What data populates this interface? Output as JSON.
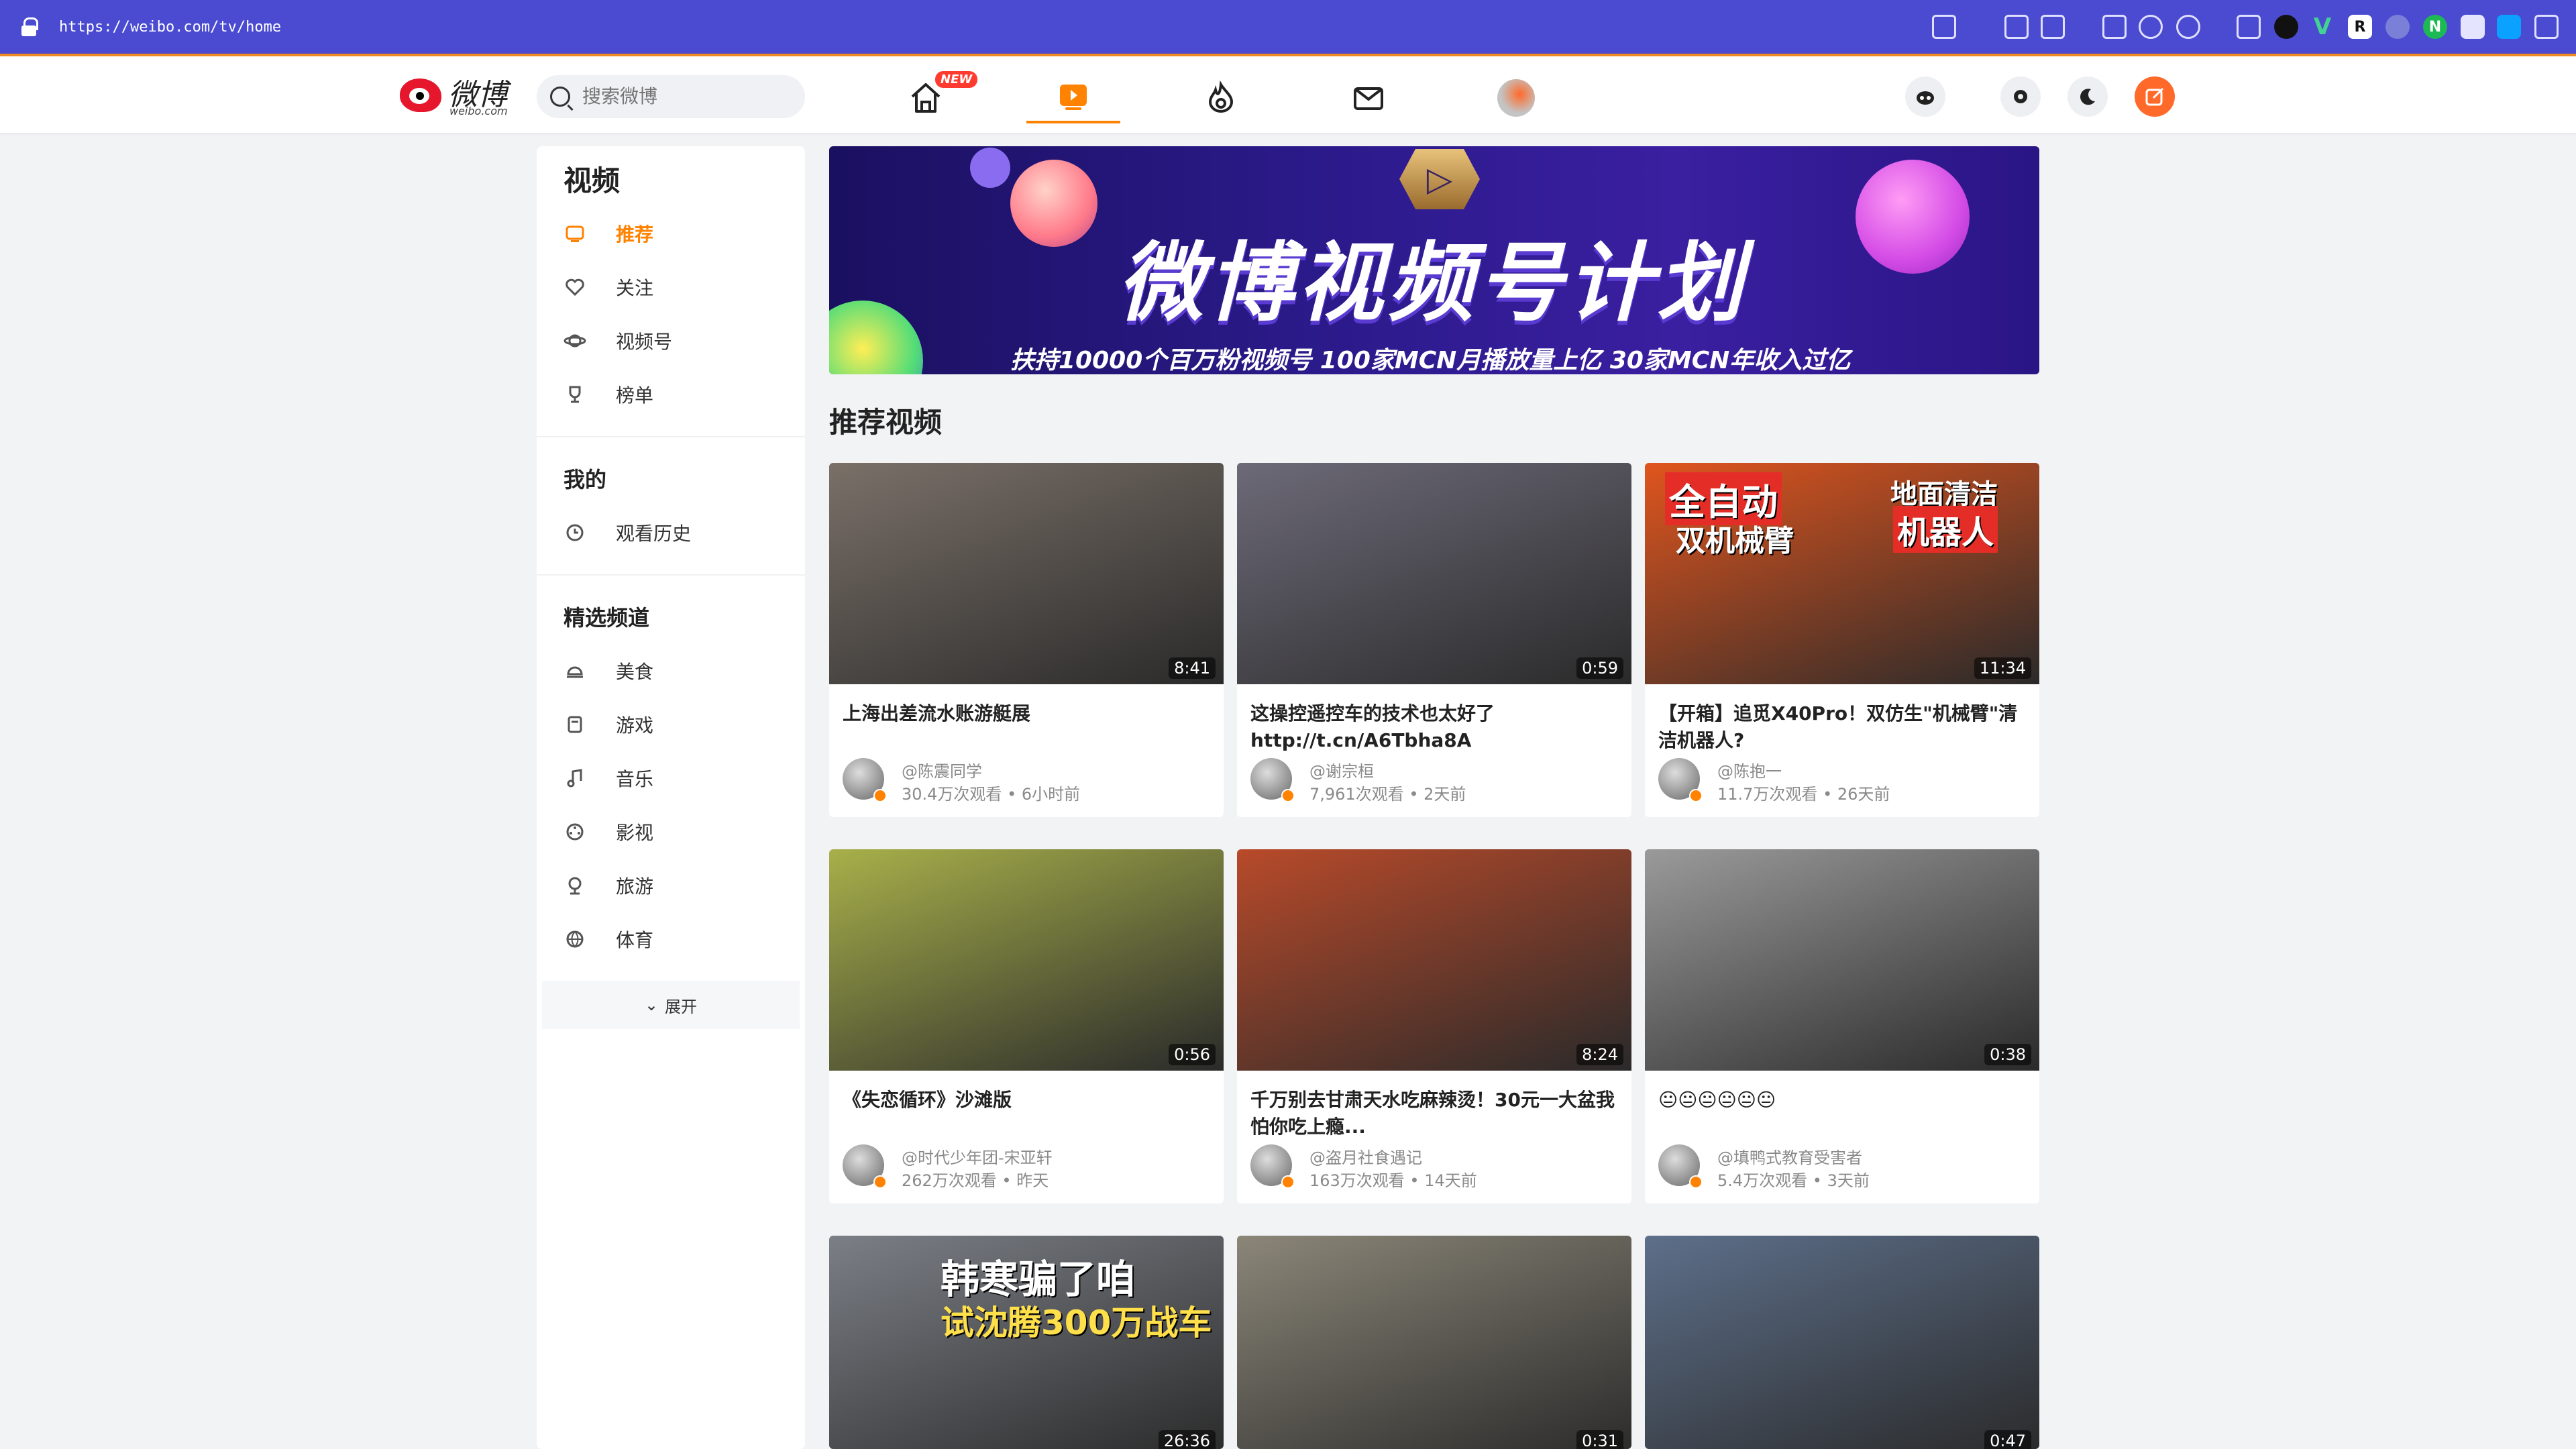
{
  "browser": {
    "url": "https://weibo.com/tv/home"
  },
  "header": {
    "logo_text": "微博",
    "logo_sub": "weibo.com",
    "search_placeholder": "搜索微博",
    "new_badge": "NEW"
  },
  "sidebar": {
    "title": "视频",
    "main_items": [
      {
        "label": "推荐",
        "icon": "tv-icon",
        "active": true
      },
      {
        "label": "关注",
        "icon": "heart-icon"
      },
      {
        "label": "视频号",
        "icon": "planet-icon"
      },
      {
        "label": "榜单",
        "icon": "trophy-icon"
      }
    ],
    "mine_title": "我的",
    "mine_items": [
      {
        "label": "观看历史",
        "icon": "clock-icon"
      }
    ],
    "channels_title": "精选频道",
    "channel_items": [
      {
        "label": "美食",
        "icon": "food-icon"
      },
      {
        "label": "游戏",
        "icon": "game-icon"
      },
      {
        "label": "音乐",
        "icon": "music-icon"
      },
      {
        "label": "影视",
        "icon": "film-icon"
      },
      {
        "label": "旅游",
        "icon": "travel-icon"
      },
      {
        "label": "体育",
        "icon": "sports-icon"
      }
    ],
    "expand_label": "展开"
  },
  "banner": {
    "title": "微博视频号计划",
    "subtitle": "扶持10000个百万粉视频号  100家MCN月播放量上亿  30家MCN年收入过亿"
  },
  "section_title": "推荐视频",
  "videos": [
    {
      "title": "上海出差流水账游艇展",
      "duration": "8:41",
      "author": "@陈震同学",
      "meta": "30.4万次观看 • 6小时前",
      "thumb": "#7a7068"
    },
    {
      "title": "这操控遥控车的技术也太好了 http://t.cn/A6Tbha8A",
      "duration": "0:59",
      "author": "@谢宗桓",
      "meta": "7,961次观看 • 2天前",
      "thumb": "#6d6a78"
    },
    {
      "title": "【开箱】追觅X40Pro！双仿生\"机械臂\"清洁机器人?",
      "duration": "11:34",
      "author": "@陈抱一",
      "meta": "11.7万次观看 • 26天前",
      "thumb": "#e0551e"
    },
    {
      "title": "《失恋循环》沙滩版",
      "duration": "0:56",
      "author": "@时代少年团-宋亚轩",
      "meta": "262万次观看 • 昨天",
      "thumb": "#a8b04a"
    },
    {
      "title": "千万别去甘肃天水吃麻辣烫！30元一大盆我怕你吃上瘾...",
      "duration": "8:24",
      "author": "@盗月社食遇记",
      "meta": "163万次观看 • 14天前",
      "thumb": "#b84a2a"
    },
    {
      "title": "😐😐😐😐😐😐",
      "duration": "0:38",
      "author": "@填鸭式教育受害者",
      "meta": "5.4万次观看 • 3天前",
      "thumb": "#9a9a9a"
    },
    {
      "title": "",
      "duration": "26:36",
      "author": "",
      "meta": "",
      "thumb": "#7b7f86"
    },
    {
      "title": "",
      "duration": "0:31",
      "author": "",
      "meta": "",
      "thumb": "#8b8678"
    },
    {
      "title": "",
      "duration": "0:47",
      "author": "",
      "meta": "",
      "thumb": "#5d6f8a"
    }
  ],
  "thumb_overlays": {
    "robot_1": "全自动",
    "robot_2": "双机械臂",
    "robot_3": "地面清洁",
    "robot_4": "机器人",
    "car_1": "韩寒骗了咱",
    "car_2": "试沈腾300万战车"
  }
}
